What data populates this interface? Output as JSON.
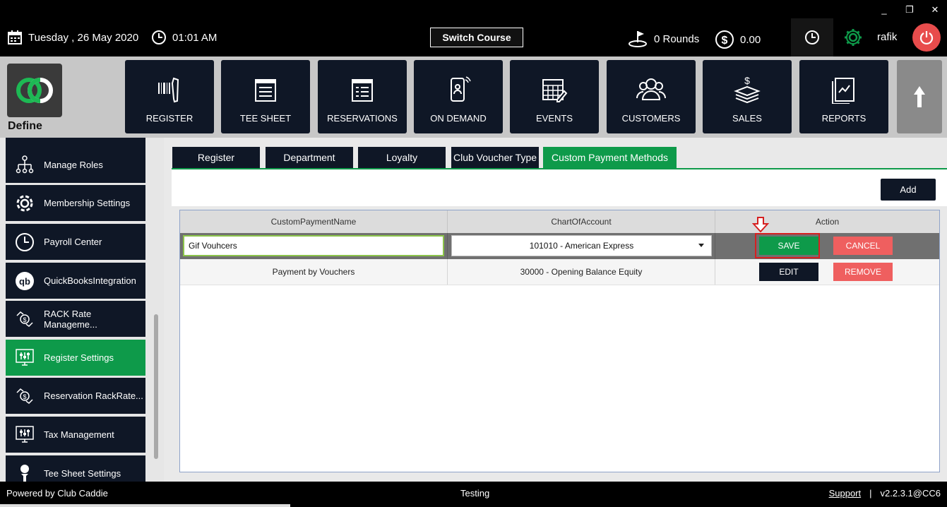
{
  "window": {
    "minimize": "_",
    "restore": "❐",
    "close": "✕"
  },
  "topbar": {
    "date": "Tuesday ,  26 May 2020",
    "time": "01:01 AM",
    "switch_course": "Switch Course",
    "rounds": "0 Rounds",
    "amount": "0.00",
    "user": "rafik"
  },
  "brand": {
    "name": "Define"
  },
  "nav": [
    {
      "label": "REGISTER",
      "icon": "barcode-scanner-icon"
    },
    {
      "label": "TEE SHEET",
      "icon": "sheet-icon"
    },
    {
      "label": "RESERVATIONS",
      "icon": "reservations-icon"
    },
    {
      "label": "ON DEMAND",
      "icon": "mobile-user-icon"
    },
    {
      "label": "EVENTS",
      "icon": "calendar-edit-icon"
    },
    {
      "label": "CUSTOMERS",
      "icon": "users-icon"
    },
    {
      "label": "SALES",
      "icon": "money-stack-icon"
    },
    {
      "label": "REPORTS",
      "icon": "report-chart-icon"
    }
  ],
  "sidebar": {
    "items": [
      {
        "label": "Manage Roles",
        "icon": "org-chart-icon"
      },
      {
        "label": "Membership Settings",
        "icon": "gear-icon"
      },
      {
        "label": "Payroll Center",
        "icon": "clock-icon"
      },
      {
        "label": "QuickBooksIntegration",
        "icon": "quickbooks-icon"
      },
      {
        "label": "RACK Rate Manageme...",
        "icon": "rate-exchange-icon"
      },
      {
        "label": "Register Settings",
        "icon": "register-settings-icon",
        "active": true
      },
      {
        "label": "Reservation RackRate...",
        "icon": "rate-exchange-icon"
      },
      {
        "label": "Tax Management",
        "icon": "tax-settings-icon"
      },
      {
        "label": "Tee Sheet Settings",
        "icon": "golf-tee-icon"
      }
    ]
  },
  "tabs": [
    {
      "label": "Register"
    },
    {
      "label": "Department"
    },
    {
      "label": "Loyalty"
    },
    {
      "label": "Club Voucher Type"
    },
    {
      "label": "Custom Payment Methods",
      "active": true
    }
  ],
  "add_label": "Add",
  "grid": {
    "columns": [
      "CustomPaymentName",
      "ChartOfAccount",
      "Action"
    ],
    "edit_row": {
      "name": "Gif Vouhcers",
      "account": "101010 - American Express",
      "save": "SAVE",
      "cancel": "CANCEL"
    },
    "rows": [
      {
        "name": "Payment by Vouchers",
        "account": "30000 - Opening Balance Equity",
        "edit": "EDIT",
        "remove": "REMOVE"
      }
    ]
  },
  "footer": {
    "powered": "Powered by Club Caddie",
    "env": "Testing",
    "support": "Support",
    "separator": "|",
    "version": "v2.2.3.1@CC6"
  },
  "colors": {
    "accent": "#0e9a4a",
    "nav": "#0f1726",
    "danger": "#ef5f5f",
    "highlight": "#d62020"
  }
}
